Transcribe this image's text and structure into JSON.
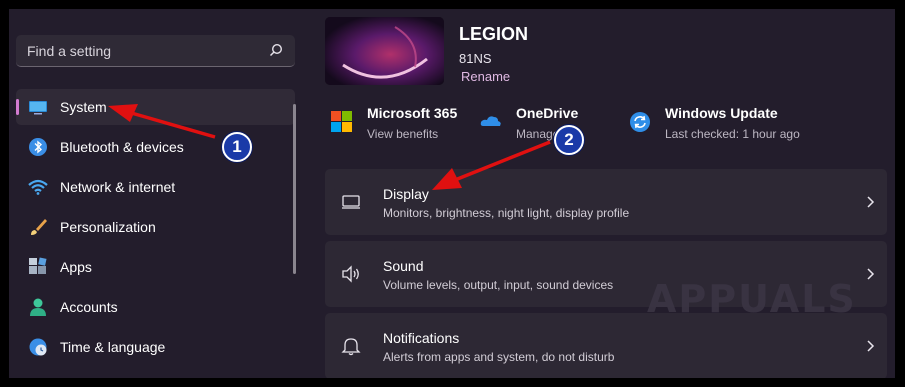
{
  "search": {
    "placeholder": "Find a setting",
    "icon": "search-icon"
  },
  "sidebar": {
    "items": [
      {
        "label": "System",
        "icon": "monitor-icon",
        "active": true
      },
      {
        "label": "Bluetooth & devices",
        "icon": "bluetooth-icon"
      },
      {
        "label": "Network & internet",
        "icon": "wifi-icon"
      },
      {
        "label": "Personalization",
        "icon": "brush-icon"
      },
      {
        "label": "Apps",
        "icon": "apps-icon"
      },
      {
        "label": "Accounts",
        "icon": "person-icon"
      },
      {
        "label": "Time & language",
        "icon": "clock-globe-icon"
      }
    ]
  },
  "device": {
    "name": "LEGION",
    "model": "81NS",
    "rename": "Rename"
  },
  "tiles": [
    {
      "title": "Microsoft 365",
      "subtitle": "View benefits",
      "icon": "microsoft-logo-icon"
    },
    {
      "title": "OneDrive",
      "subtitle": "Manage",
      "icon": "onedrive-icon"
    },
    {
      "title": "Windows Update",
      "subtitle": "Last checked: 1 hour ago",
      "icon": "windows-update-icon"
    }
  ],
  "cards": [
    {
      "title": "Display",
      "subtitle": "Monitors, brightness, night light, display profile",
      "icon": "display-icon"
    },
    {
      "title": "Sound",
      "subtitle": "Volume levels, output, input, sound devices",
      "icon": "speaker-icon"
    },
    {
      "title": "Notifications",
      "subtitle": "Alerts from apps and system, do not disturb",
      "icon": "bell-icon"
    }
  ],
  "annotations": {
    "badge1": "1",
    "badge2": "2"
  },
  "watermark": "APPUALS",
  "colors": {
    "accent": "#d27bd0",
    "badge": "#1a3aa8",
    "arrow": "#e01010"
  }
}
